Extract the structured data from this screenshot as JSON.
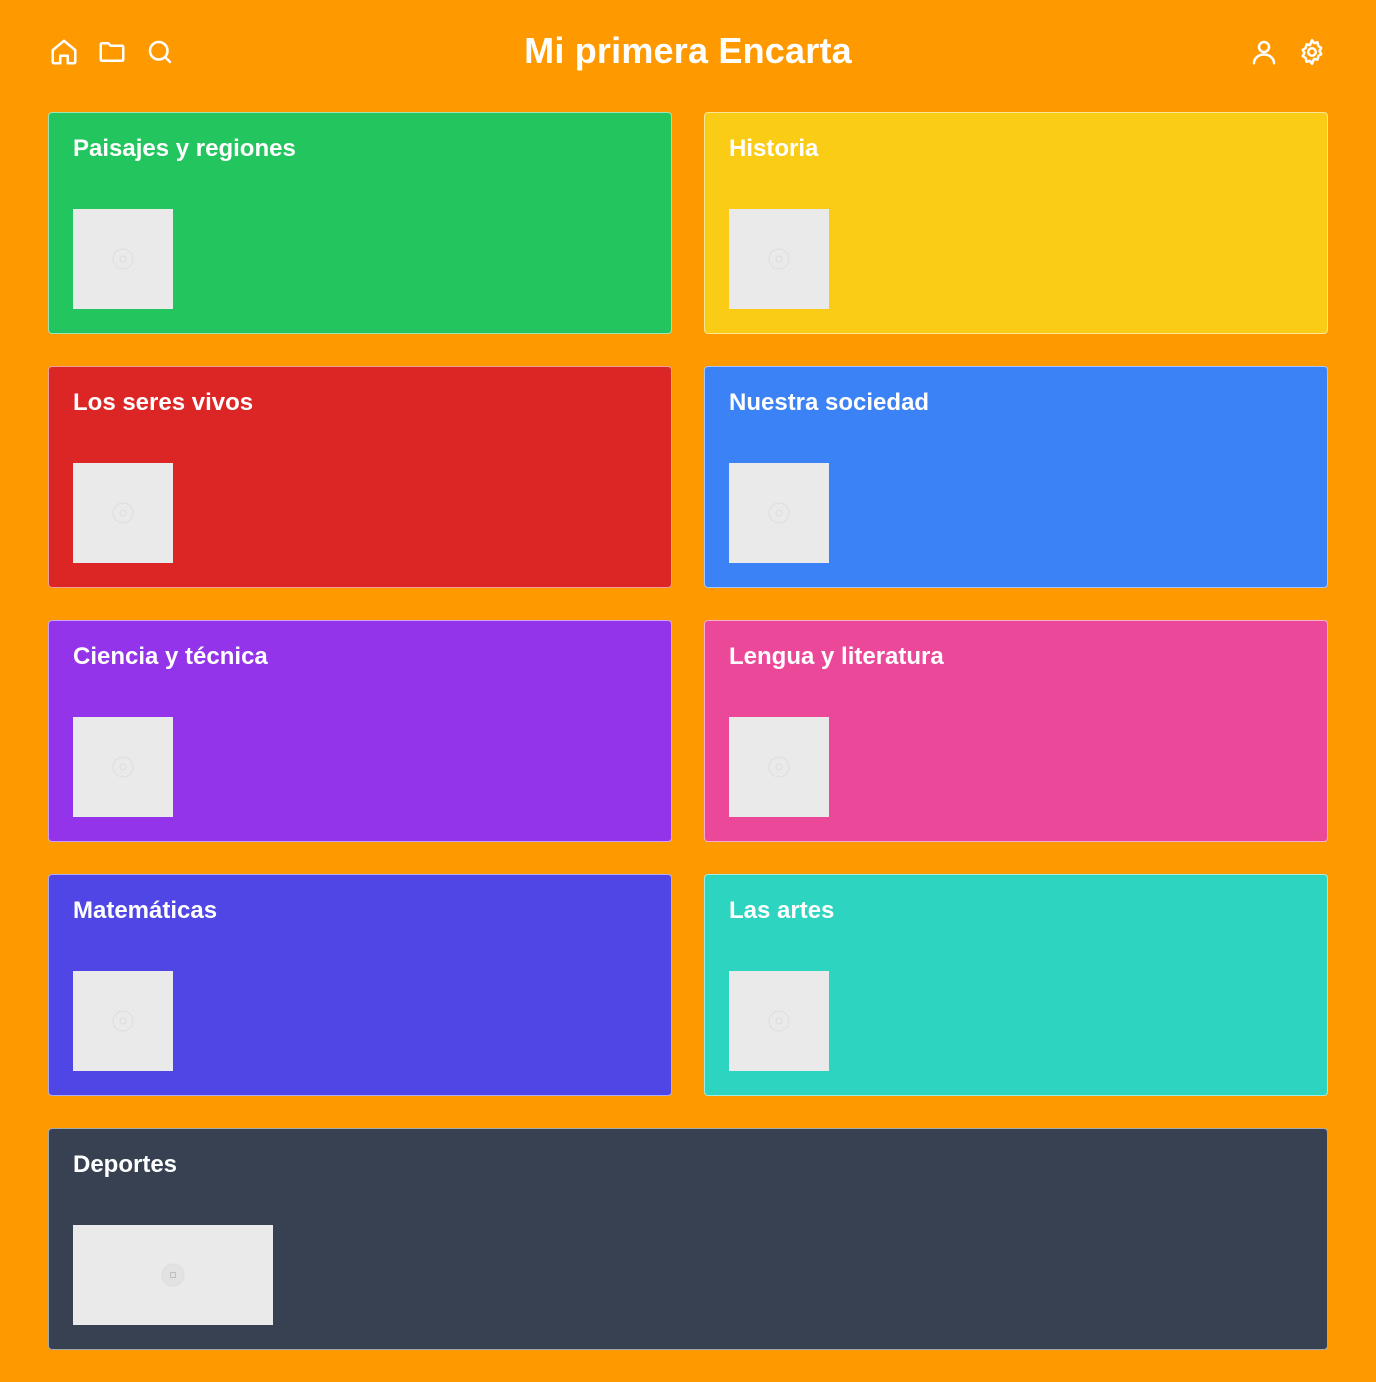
{
  "app": {
    "title": "Mi primera Encarta"
  },
  "header": {
    "left_icons": [
      "home-icon",
      "folder-icon",
      "search-icon"
    ],
    "right_icons": [
      "user-icon",
      "settings-icon"
    ]
  },
  "colors": {
    "background": "#FF9900",
    "paisajes": "#22C55E",
    "historia": "#FACC15",
    "seres_vivos": "#DC2626",
    "sociedad": "#3B82F6",
    "ciencia": "#9333EA",
    "lengua": "#EC4899",
    "matematicas": "#4F46E5",
    "artes": "#2DD4BF",
    "deportes": "#374151"
  },
  "categories": [
    {
      "title": "Paisajes y regiones",
      "color_key": "paisajes"
    },
    {
      "title": "Historia",
      "color_key": "historia"
    },
    {
      "title": "Los seres vivos",
      "color_key": "seres_vivos"
    },
    {
      "title": "Nuestra sociedad",
      "color_key": "sociedad"
    },
    {
      "title": "Ciencia y técnica",
      "color_key": "ciencia"
    },
    {
      "title": "Lengua y literatura",
      "color_key": "lengua"
    },
    {
      "title": "Matemáticas",
      "color_key": "matematicas"
    },
    {
      "title": "Las artes",
      "color_key": "artes"
    },
    {
      "title": "Deportes",
      "color_key": "deportes"
    }
  ]
}
